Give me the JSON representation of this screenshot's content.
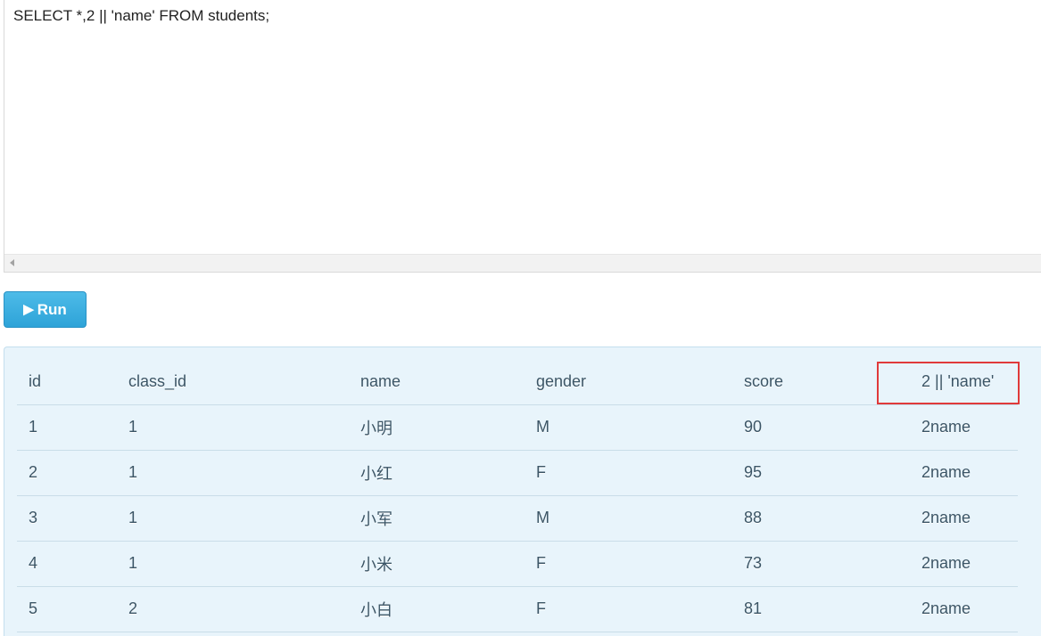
{
  "editor": {
    "query": "SELECT *,2 || 'name' FROM students;"
  },
  "run_button": {
    "label": "Run",
    "icon": "play-icon"
  },
  "result_table": {
    "columns": [
      "id",
      "class_id",
      "name",
      "gender",
      "score",
      "2 || 'name'"
    ],
    "rows": [
      [
        "1",
        "1",
        "小明",
        "M",
        "90",
        "2name"
      ],
      [
        "2",
        "1",
        "小红",
        "F",
        "95",
        "2name"
      ],
      [
        "3",
        "1",
        "小军",
        "M",
        "88",
        "2name"
      ],
      [
        "4",
        "1",
        "小米",
        "F",
        "73",
        "2name"
      ],
      [
        "5",
        "2",
        "小白",
        "F",
        "81",
        "2name"
      ]
    ]
  },
  "colors": {
    "run_button": "#2ea3d8",
    "result_background": "#e8f4fb",
    "highlight_box": "#e03a3a"
  }
}
